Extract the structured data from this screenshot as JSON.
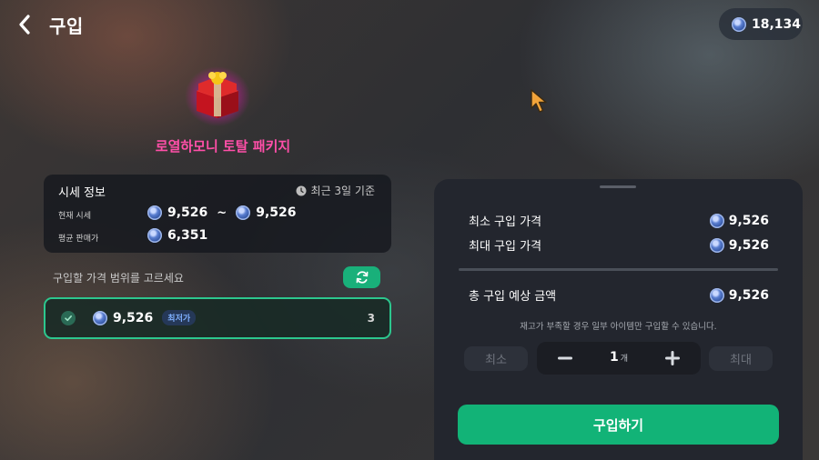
{
  "header": {
    "title": "구입",
    "balance": "18,134"
  },
  "product": {
    "name": "로열하모니 토탈 패키지",
    "icon": "gift-chest-icon"
  },
  "market_info": {
    "title": "시세 정보",
    "period": "최근 3일 기준",
    "current_label": "현재 시세",
    "current_min": "9,526",
    "range_sep": "~",
    "current_max": "9,526",
    "avg_label": "평균 판매가",
    "avg_value": "6,351"
  },
  "range_select": {
    "prompt": "구입할 가격 범위를 고르세요",
    "option": {
      "price": "9,526",
      "badge": "최저가",
      "qty": "3",
      "selected": true
    }
  },
  "purchase": {
    "min_label": "최소 구입 가격",
    "min_value": "9,526",
    "max_label": "최대 구입 가격",
    "max_value": "9,526",
    "total_label": "총 구입 예상 금액",
    "total_value": "9,526",
    "notice": "재고가 부족할 경우 일부 아이템만 구입할 수 있습니다.",
    "min_button": "최소",
    "max_button": "최대",
    "quantity": "1",
    "quantity_unit": "개",
    "buy_button": "구입하기"
  },
  "colors": {
    "accent_green": "#12b377",
    "product_name": "#ff4fa8",
    "sheet_bg": "#23262e"
  }
}
